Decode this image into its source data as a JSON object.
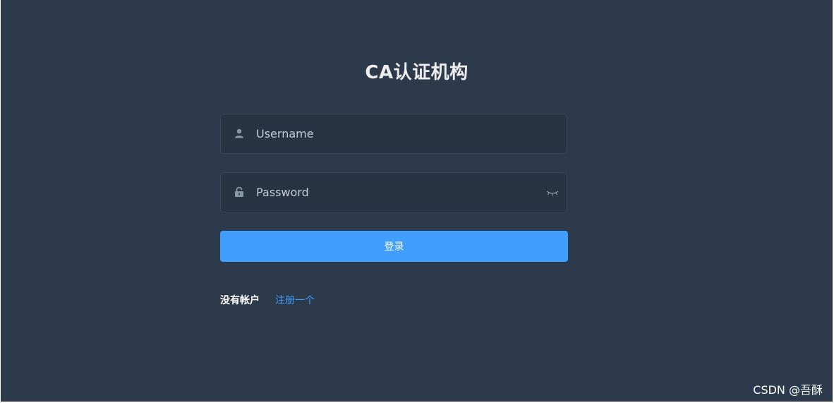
{
  "login": {
    "title": "CA认证机构",
    "username_placeholder": "Username",
    "password_placeholder": "Password",
    "submit_label": "登录",
    "no_account_text": "没有帐户",
    "register_link": "注册一个"
  },
  "icons": {
    "username": "user-icon",
    "password": "lock-icon",
    "toggle_visibility": "eye-closed-icon"
  },
  "colors": {
    "background": "#2d3a4b",
    "input_background": "#283443",
    "primary": "#409eff",
    "text": "#eeeeee"
  },
  "watermark": "CSDN @吾酥"
}
